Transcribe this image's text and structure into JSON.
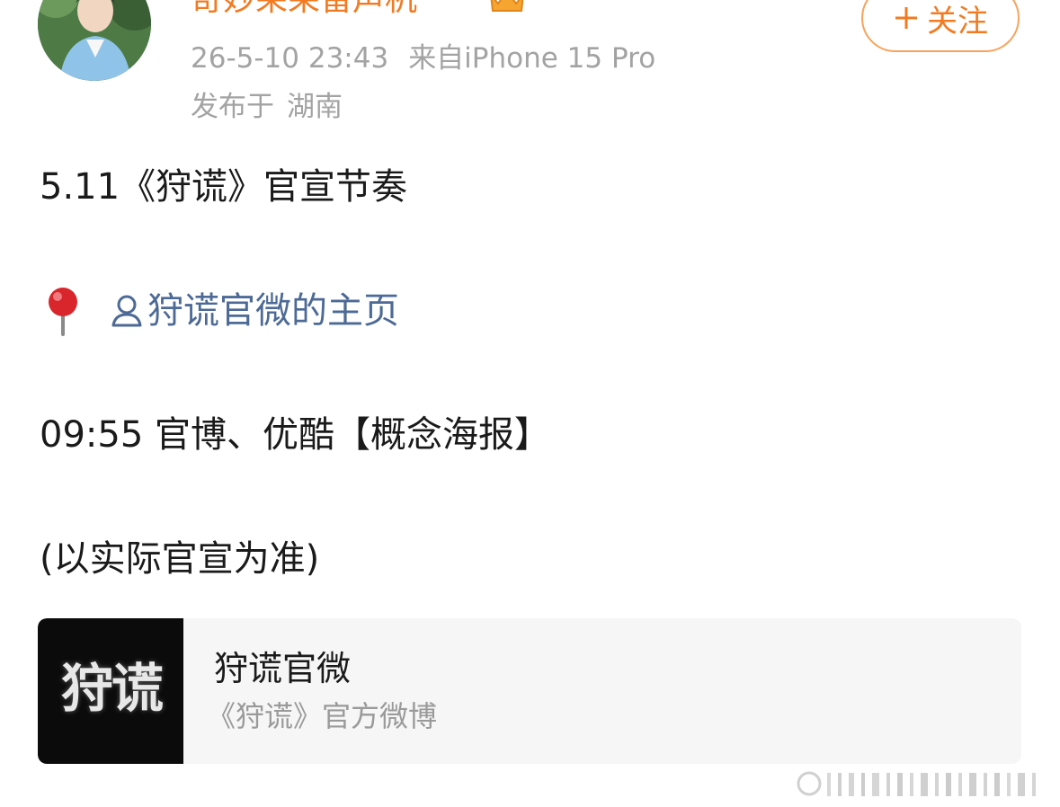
{
  "post": {
    "author": {
      "name": "奇妙呆呆留声机",
      "avatar_icon": "avatar-photo",
      "badge_icon": "vip-crown-icon"
    },
    "time": "26-5-10 23:43",
    "source": "来自iPhone 15 Pro",
    "location_prefix": "发布于",
    "location": "湖南",
    "follow_label": "关注",
    "follow_icon": "plus-icon",
    "content": {
      "line1": "5.11《狩谎》官宣节奏",
      "pin_icon": "round-pushpin-icon",
      "user_link_icon": "person-icon",
      "user_link": "狩谎官微的主页",
      "line3": "09:55 官博、优酷【概念海报】",
      "line4": "(以实际官宣为准)"
    },
    "card": {
      "thumb_text": "狩谎",
      "title": "狩谎官微",
      "subtitle": "《狩谎》官方微博"
    }
  },
  "colors": {
    "accent": "#f27b22",
    "link": "#4d6a96",
    "meta": "#a3a3a3",
    "card_bg": "#f6f6f6"
  }
}
